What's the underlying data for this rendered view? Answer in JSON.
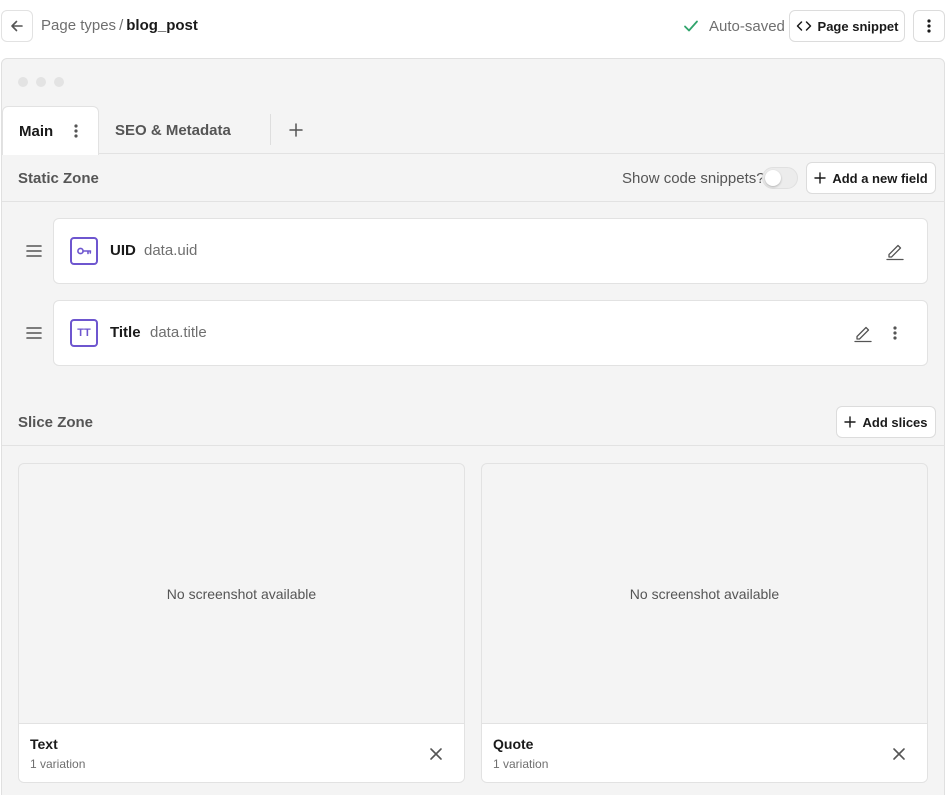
{
  "header": {
    "breadcrumb_parent": "Page types",
    "breadcrumb_separator": "/",
    "breadcrumb_current": "blog_post",
    "status": "Auto-saved",
    "snippet_button": "Page snippet"
  },
  "tabs": [
    {
      "label": "Main",
      "active": true
    },
    {
      "label": "SEO & Metadata",
      "active": false
    }
  ],
  "static_zone": {
    "title": "Static Zone",
    "show_snippets_label": "Show code snippets?",
    "show_snippets_on": false,
    "add_field_button": "Add a new field",
    "fields": [
      {
        "name": "UID",
        "key": "data.uid",
        "icon": "key-icon"
      },
      {
        "name": "Title",
        "key": "data.title",
        "icon": "title-icon",
        "icon_text": "TT"
      }
    ]
  },
  "slice_zone": {
    "title": "Slice Zone",
    "add_button": "Add slices",
    "slices": [
      {
        "name": "Text",
        "variations": "1 variation",
        "preview": "No screenshot available"
      },
      {
        "name": "Quote",
        "variations": "1 variation",
        "preview": "No screenshot available"
      }
    ]
  },
  "colors": {
    "accent": "#6e56cf",
    "success": "#30a46c"
  }
}
